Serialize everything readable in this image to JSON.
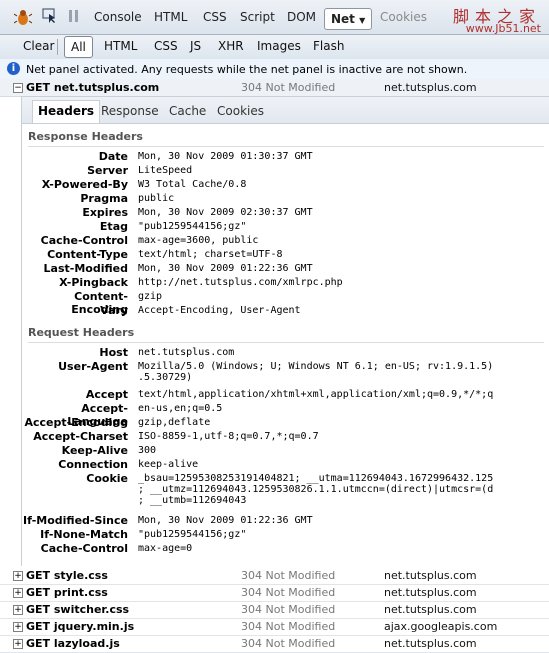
{
  "toolbar": {
    "tabs": [
      "Console",
      "HTML",
      "CSS",
      "Script",
      "DOM",
      "Net",
      "Cookies"
    ],
    "active_tab": "Net",
    "watermark_cn": "脚本之家",
    "watermark_url": "www.Jb51.net"
  },
  "filters": [
    "Clear",
    "All",
    "HTML",
    "CSS",
    "JS",
    "XHR",
    "Images",
    "Flash"
  ],
  "selected_filter": "All",
  "info": {
    "text": "Net panel activated. Any requests while the net panel is inactive are not shown."
  },
  "main_request": {
    "url": "GET net.tutsplus.com",
    "status": "304 Not Modified",
    "domain": "net.tutsplus.com"
  },
  "detail_tabs": [
    "Headers",
    "Response",
    "Cache",
    "Cookies"
  ],
  "active_detail_tab": "Headers",
  "response_title": "Response Headers",
  "response_headers": [
    {
      "name": "Date",
      "value": "Mon, 30 Nov 2009 01:30:37 GMT"
    },
    {
      "name": "Server",
      "value": "LiteSpeed"
    },
    {
      "name": "X-Powered-By",
      "value": "W3 Total Cache/0.8"
    },
    {
      "name": "Pragma",
      "value": "public"
    },
    {
      "name": "Expires",
      "value": "Mon, 30 Nov 2009 02:30:37 GMT"
    },
    {
      "name": "Etag",
      "value": "\"pub1259544156;gz\""
    },
    {
      "name": "Cache-Control",
      "value": "max-age=3600, public"
    },
    {
      "name": "Content-Type",
      "value": "text/html; charset=UTF-8"
    },
    {
      "name": "Last-Modified",
      "value": "Mon, 30 Nov 2009 01:22:36 GMT"
    },
    {
      "name": "X-Pingback",
      "value": "http://net.tutsplus.com/xmlrpc.php"
    },
    {
      "name": "Content-Encoding",
      "value": "gzip"
    },
    {
      "name": "Vary",
      "value": "Accept-Encoding, User-Agent"
    }
  ],
  "request_title": "Request Headers",
  "request_headers": [
    {
      "name": "Host",
      "value": "net.tutsplus.com"
    },
    {
      "name": "User-Agent",
      "value": "Mozilla/5.0 (Windows; U; Windows NT 6.1; en-US; rv:1.9.1.5)\n.5.30729)"
    },
    {
      "name": "Accept",
      "value": "text/html,application/xhtml+xml,application/xml;q=0.9,*/*;q"
    },
    {
      "name": "Accept-Language",
      "value": "en-us,en;q=0.5"
    },
    {
      "name": "Accept-Encoding",
      "value": "gzip,deflate"
    },
    {
      "name": "Accept-Charset",
      "value": "ISO-8859-1,utf-8;q=0.7,*;q=0.7"
    },
    {
      "name": "Keep-Alive",
      "value": "300"
    },
    {
      "name": "Connection",
      "value": "keep-alive"
    },
    {
      "name": "Cookie",
      "value": "_bsau=12595308253191404821; __utma=112694043.1672996432.125\n; __utmz=112694043.1259530826.1.1.utmccn=(direct)|utmcsr=(d\n; __utmb=112694043"
    },
    {
      "name": "If-Modified-Since",
      "value": "Mon, 30 Nov 2009 01:22:36 GMT"
    },
    {
      "name": "If-None-Match",
      "value": "\"pub1259544156;gz\""
    },
    {
      "name": "Cache-Control",
      "value": "max-age=0"
    }
  ],
  "other_requests": [
    {
      "url": "GET style.css",
      "status": "304 Not Modified",
      "domain": "net.tutsplus.com"
    },
    {
      "url": "GET print.css",
      "status": "304 Not Modified",
      "domain": "net.tutsplus.com"
    },
    {
      "url": "GET switcher.css",
      "status": "304 Not Modified",
      "domain": "net.tutsplus.com"
    },
    {
      "url": "GET jquery.min.js",
      "status": "304 Not Modified",
      "domain": "ajax.googleapis.com"
    },
    {
      "url": "GET lazyload.js",
      "status": "304 Not Modified",
      "domain": "net.tutsplus.com"
    }
  ]
}
